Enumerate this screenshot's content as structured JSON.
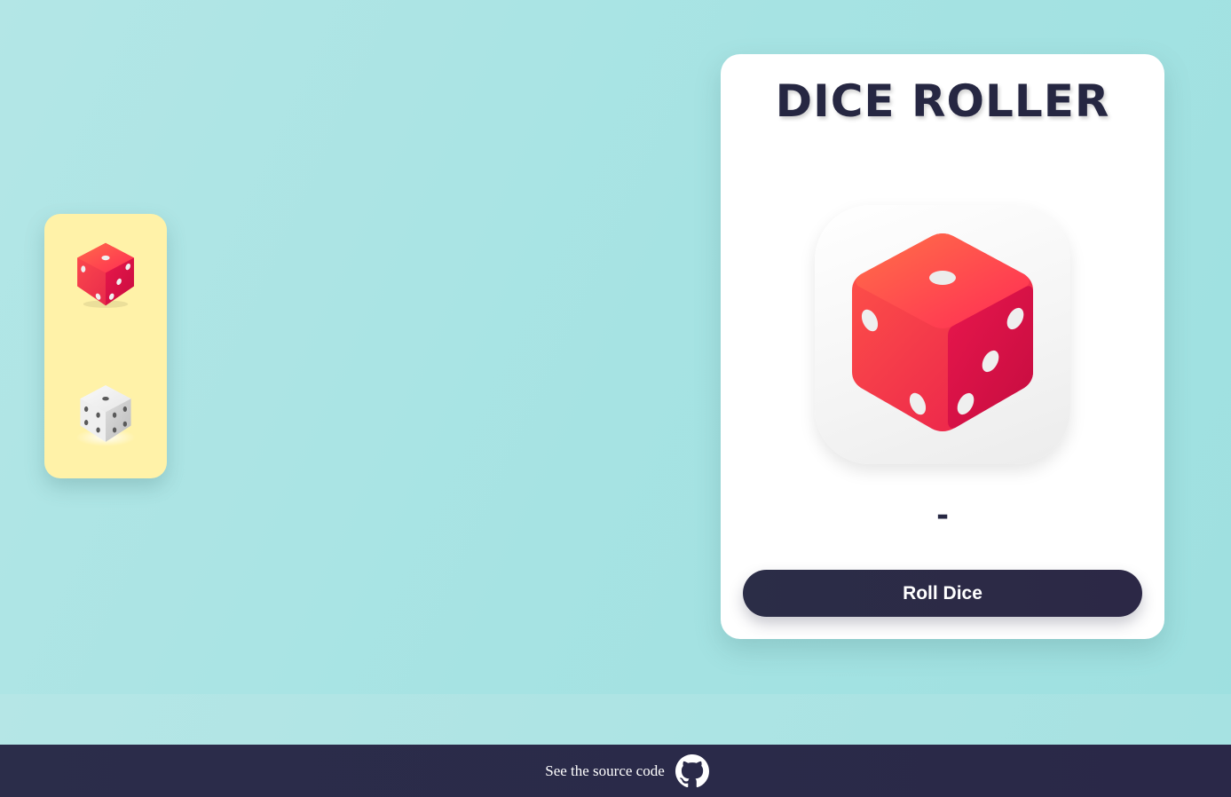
{
  "app": {
    "title": "DICE ROLLER",
    "result": "-",
    "roll_button_label": "Roll Dice"
  },
  "side_panel": {
    "dice": [
      {
        "name": "red-die",
        "color": "#ff3b4e",
        "selected": true
      },
      {
        "name": "white-die",
        "color": "#eeeeee",
        "selected": false
      }
    ]
  },
  "footer": {
    "link_text": "See the source code",
    "icon": "github-icon"
  },
  "colors": {
    "background": "#a6e3e3",
    "panel": "#fff2a8",
    "dark": "#2b2d47",
    "die_red": "#ff3b4e",
    "die_pip": "#f2f2f2"
  }
}
